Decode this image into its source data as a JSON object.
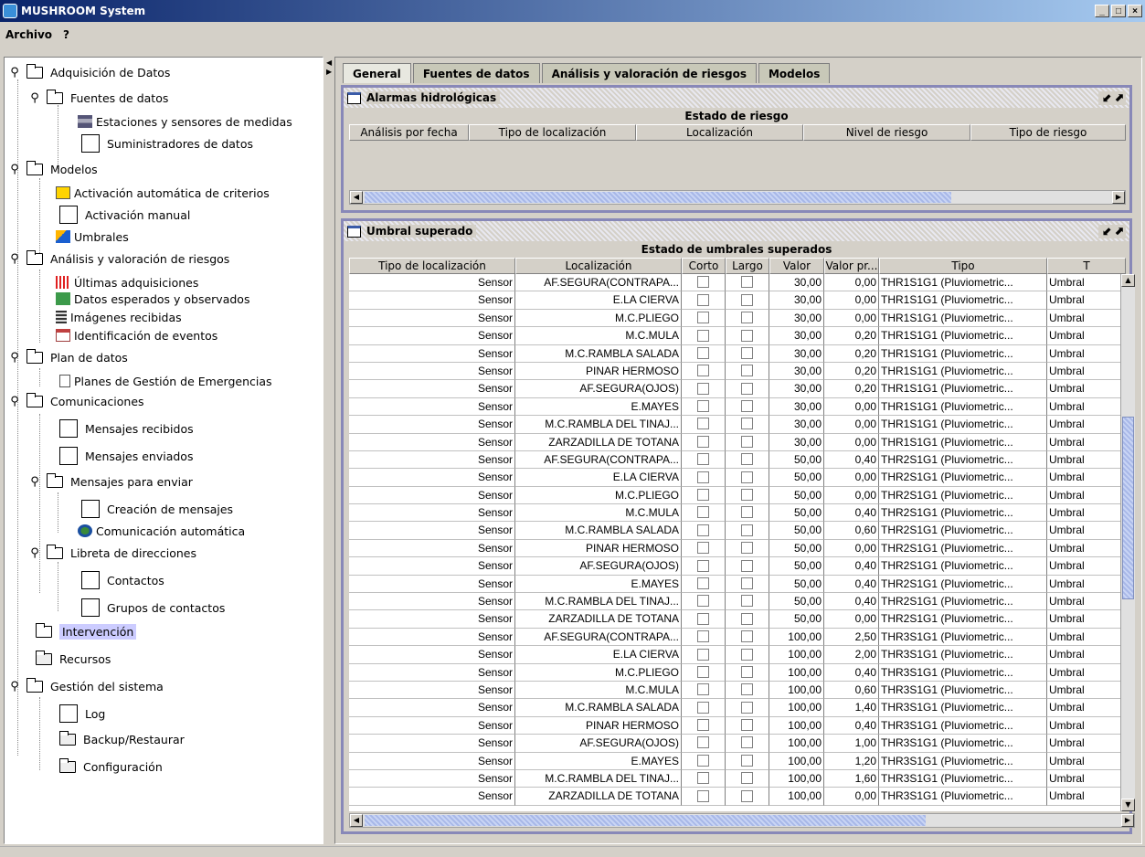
{
  "window": {
    "title": "MUSHROOM System",
    "btn_min": "_",
    "btn_max": "□",
    "btn_close": "×"
  },
  "menu": [
    "Archivo",
    "?"
  ],
  "tree": {
    "adquisicion": "Adquisición de Datos",
    "fuentes": "Fuentes de datos",
    "estaciones": "Estaciones y sensores de medidas",
    "suministradores": "Suministradores de datos",
    "modelos": "Modelos",
    "activacion_auto": "Activación automática de criterios",
    "activacion_manual": "Activación manual",
    "umbrales": "Umbrales",
    "analisis": "Análisis y valoración de riesgos",
    "ultimas": "Últimas adquisiciones",
    "esperados": "Datos esperados y observados",
    "imagenes": "Imágenes recibidas",
    "identificacion": "Identificación de eventos",
    "plan": "Plan de datos",
    "planes": "Planes de Gestión de Emergencias",
    "comunicaciones": "Comunicaciones",
    "recibidos": "Mensajes recibidos",
    "enviados": "Mensajes enviados",
    "para_enviar": "Mensajes para enviar",
    "creacion": "Creación de mensajes",
    "com_auto": "Comunicación automática",
    "libreta": "Libreta de direcciones",
    "contactos": "Contactos",
    "grupos": "Grupos de contactos",
    "intervencion": "Intervención",
    "recursos": "Recursos",
    "gestion": "Gestión del sistema",
    "log": "Log",
    "backup": "Backup/Restaurar",
    "configuracion": "Configuración"
  },
  "tabs": [
    "General",
    "Fuentes de datos",
    "Análisis y valoración de riesgos",
    "Modelos"
  ],
  "alarmas": {
    "title": "Alarmas hidrológicas",
    "controls": "⬋⬈",
    "subtitle": "Estado de riesgo",
    "columns": [
      "Análisis por fecha",
      "Tipo de localización",
      "Localización",
      "Nivel de riesgo",
      "Tipo de riesgo"
    ]
  },
  "umbral": {
    "title": "Umbral superado",
    "controls": "⬋⬈",
    "subtitle": "Estado de umbrales superados",
    "columns": [
      "Tipo de localización",
      "Localización",
      "Corto",
      "Largo",
      "Valor",
      "Valor pr...",
      "Tipo",
      "T"
    ],
    "rows": [
      [
        "Sensor",
        "AF.SEGURA(CONTRAPA...",
        "30,00",
        "0,00",
        "THR1S1G1 (Pluviometric...",
        "Umbral"
      ],
      [
        "Sensor",
        "E.LA CIERVA",
        "30,00",
        "0,00",
        "THR1S1G1 (Pluviometric...",
        "Umbral"
      ],
      [
        "Sensor",
        "M.C.PLIEGO",
        "30,00",
        "0,00",
        "THR1S1G1 (Pluviometric...",
        "Umbral"
      ],
      [
        "Sensor",
        "M.C.MULA",
        "30,00",
        "0,20",
        "THR1S1G1 (Pluviometric...",
        "Umbral"
      ],
      [
        "Sensor",
        "M.C.RAMBLA SALADA",
        "30,00",
        "0,20",
        "THR1S1G1 (Pluviometric...",
        "Umbral"
      ],
      [
        "Sensor",
        "PINAR HERMOSO",
        "30,00",
        "0,20",
        "THR1S1G1 (Pluviometric...",
        "Umbral"
      ],
      [
        "Sensor",
        "AF.SEGURA(OJOS)",
        "30,00",
        "0,20",
        "THR1S1G1 (Pluviometric...",
        "Umbral"
      ],
      [
        "Sensor",
        "E.MAYES",
        "30,00",
        "0,00",
        "THR1S1G1 (Pluviometric...",
        "Umbral"
      ],
      [
        "Sensor",
        "M.C.RAMBLA DEL TINAJ...",
        "30,00",
        "0,00",
        "THR1S1G1 (Pluviometric...",
        "Umbral"
      ],
      [
        "Sensor",
        "ZARZADILLA DE TOTANA",
        "30,00",
        "0,00",
        "THR1S1G1 (Pluviometric...",
        "Umbral"
      ],
      [
        "Sensor",
        "AF.SEGURA(CONTRAPA...",
        "50,00",
        "0,40",
        "THR2S1G1 (Pluviometric...",
        "Umbral"
      ],
      [
        "Sensor",
        "E.LA CIERVA",
        "50,00",
        "0,00",
        "THR2S1G1 (Pluviometric...",
        "Umbral"
      ],
      [
        "Sensor",
        "M.C.PLIEGO",
        "50,00",
        "0,00",
        "THR2S1G1 (Pluviometric...",
        "Umbral"
      ],
      [
        "Sensor",
        "M.C.MULA",
        "50,00",
        "0,40",
        "THR2S1G1 (Pluviometric...",
        "Umbral"
      ],
      [
        "Sensor",
        "M.C.RAMBLA SALADA",
        "50,00",
        "0,60",
        "THR2S1G1 (Pluviometric...",
        "Umbral"
      ],
      [
        "Sensor",
        "PINAR HERMOSO",
        "50,00",
        "0,00",
        "THR2S1G1 (Pluviometric...",
        "Umbral"
      ],
      [
        "Sensor",
        "AF.SEGURA(OJOS)",
        "50,00",
        "0,40",
        "THR2S1G1 (Pluviometric...",
        "Umbral"
      ],
      [
        "Sensor",
        "E.MAYES",
        "50,00",
        "0,40",
        "THR2S1G1 (Pluviometric...",
        "Umbral"
      ],
      [
        "Sensor",
        "M.C.RAMBLA DEL TINAJ...",
        "50,00",
        "0,40",
        "THR2S1G1 (Pluviometric...",
        "Umbral"
      ],
      [
        "Sensor",
        "ZARZADILLA DE TOTANA",
        "50,00",
        "0,00",
        "THR2S1G1 (Pluviometric...",
        "Umbral"
      ],
      [
        "Sensor",
        "AF.SEGURA(CONTRAPA...",
        "100,00",
        "2,50",
        "THR3S1G1 (Pluviometric...",
        "Umbral"
      ],
      [
        "Sensor",
        "E.LA CIERVA",
        "100,00",
        "2,00",
        "THR3S1G1 (Pluviometric...",
        "Umbral"
      ],
      [
        "Sensor",
        "M.C.PLIEGO",
        "100,00",
        "0,40",
        "THR3S1G1 (Pluviometric...",
        "Umbral"
      ],
      [
        "Sensor",
        "M.C.MULA",
        "100,00",
        "0,60",
        "THR3S1G1 (Pluviometric...",
        "Umbral"
      ],
      [
        "Sensor",
        "M.C.RAMBLA SALADA",
        "100,00",
        "1,40",
        "THR3S1G1 (Pluviometric...",
        "Umbral"
      ],
      [
        "Sensor",
        "PINAR HERMOSO",
        "100,00",
        "0,40",
        "THR3S1G1 (Pluviometric...",
        "Umbral"
      ],
      [
        "Sensor",
        "AF.SEGURA(OJOS)",
        "100,00",
        "1,00",
        "THR3S1G1 (Pluviometric...",
        "Umbral"
      ],
      [
        "Sensor",
        "E.MAYES",
        "100,00",
        "1,20",
        "THR3S1G1 (Pluviometric...",
        "Umbral"
      ],
      [
        "Sensor",
        "M.C.RAMBLA DEL TINAJ...",
        "100,00",
        "1,60",
        "THR3S1G1 (Pluviometric...",
        "Umbral"
      ],
      [
        "Sensor",
        "ZARZADILLA DE TOTANA",
        "100,00",
        "0,00",
        "THR3S1G1 (Pluviometric...",
        "Umbral"
      ]
    ]
  },
  "colors": {
    "accent": "#0a246a",
    "panel_border": "#8888b8",
    "selected": "#ccccff"
  }
}
